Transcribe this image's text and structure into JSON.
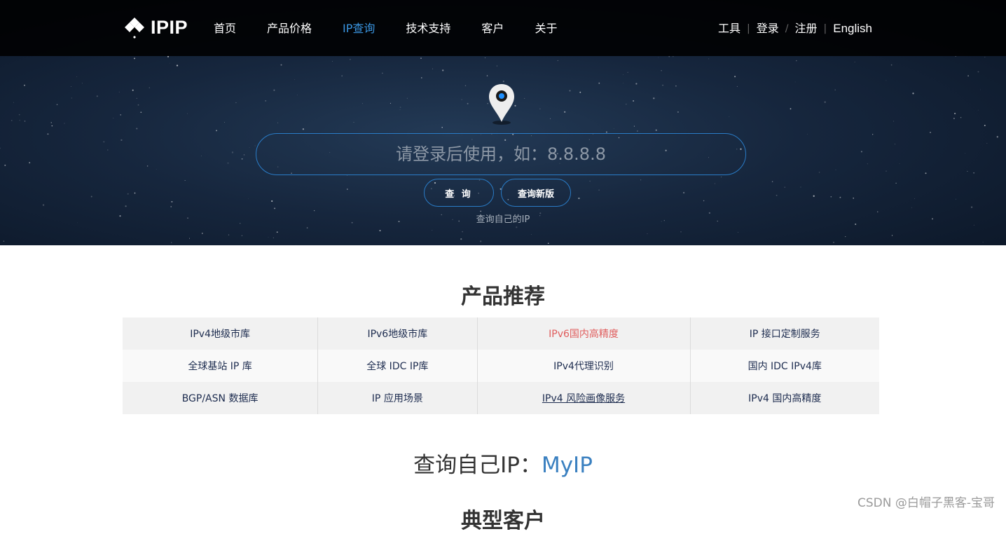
{
  "brand": {
    "logo_text": "IPIP"
  },
  "nav": {
    "items": [
      {
        "label": "首页",
        "active": false
      },
      {
        "label": "产品价格",
        "active": false
      },
      {
        "label": "IP查询",
        "active": true
      },
      {
        "label": "技术支持",
        "active": false
      },
      {
        "label": "客户",
        "active": false
      },
      {
        "label": "关于",
        "active": false
      }
    ]
  },
  "header_right": {
    "tools": "工具",
    "login": "登录",
    "register": "注册",
    "english": "English",
    "sep1": "|",
    "sep2": "/",
    "sep3": "|"
  },
  "search": {
    "placeholder": "请登录后使用，如：8.8.8.8",
    "query_button": "查 询",
    "new_version_button": "查询新版",
    "self_ip_link": "查询自己的IP"
  },
  "products": {
    "title": "产品推荐",
    "rows": [
      [
        "IPv4地级市库",
        "IPv6地级市库",
        "IPv6国内高精度",
        "IP 接口定制服务"
      ],
      [
        "全球基站 IP 库",
        "全球 IDC IP库",
        "IPv4代理识别",
        "国内 IDC IPv4库"
      ],
      [
        "BGP/ASN 数据库",
        "IP 应用场景",
        "IPv4 风险画像服务",
        "IPv4 国内高精度"
      ]
    ]
  },
  "myip": {
    "prefix": "查询自己IP：",
    "link": "MyIP"
  },
  "next_section_title": "典型客户",
  "watermark": "CSDN @白帽子黑客-宝哥",
  "colors": {
    "accent": "#3a95e0",
    "hot": "#e05d5d",
    "link_dark": "#1d2c4f",
    "topbar": "#000000"
  }
}
